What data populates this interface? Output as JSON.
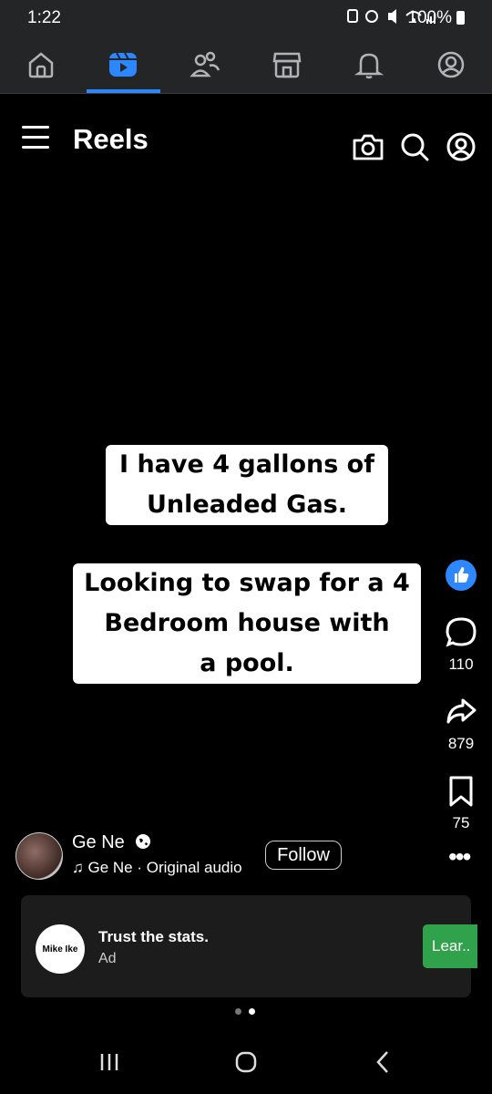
{
  "status": {
    "time": "1:22",
    "battery": "100%"
  },
  "nav": {
    "items": [
      "home",
      "reels",
      "friends",
      "marketplace",
      "notifications",
      "profile"
    ],
    "active": "reels"
  },
  "header": {
    "title": "Reels"
  },
  "captions": {
    "line1": "I have 4 gallons of",
    "line2": "Unleaded Gas.",
    "line3": "Looking to swap for a 4",
    "line4": "Bedroom house with",
    "line5": "a pool."
  },
  "actions": {
    "comments": "110",
    "shares": "879",
    "saves": "75"
  },
  "post": {
    "username": "Ge Ne",
    "audio": "Ge Ne · Original audio",
    "follow": "Follow"
  },
  "ad": {
    "logo_text": "Mike Ike",
    "title": "Trust the stats.",
    "label": "Ad",
    "cta": "Lear.."
  },
  "colors": {
    "accent": "#2d88ff",
    "cta": "#31a24c"
  }
}
